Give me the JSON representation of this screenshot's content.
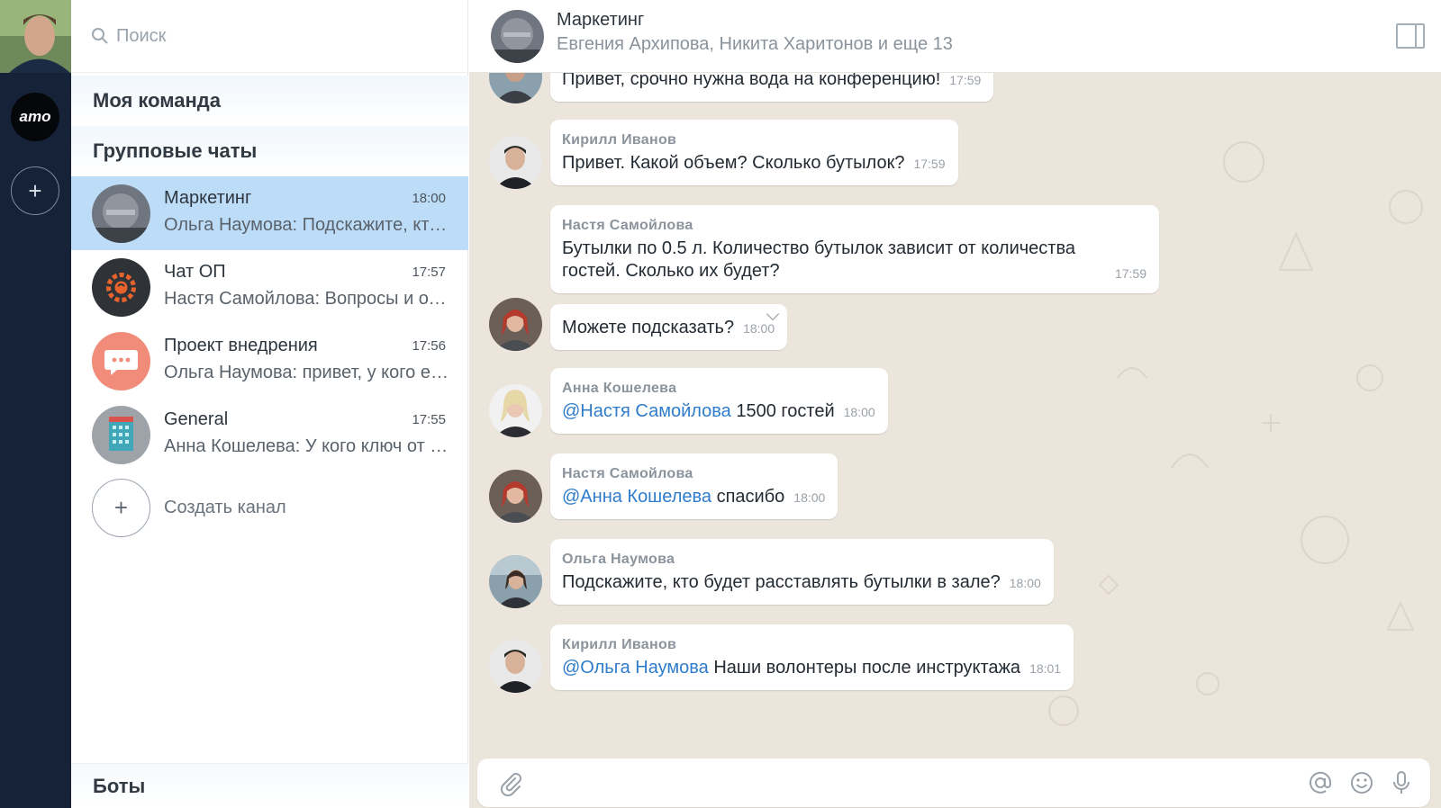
{
  "sidebar": {
    "logo_text": "amo"
  },
  "chat_list": {
    "search_placeholder": "Поиск",
    "sections": {
      "my_team": "Моя команда",
      "group_chats": "Групповые чаты",
      "bots": "Боты"
    },
    "chats": [
      {
        "name": "Маркетинг",
        "time": "18:00",
        "preview": "Ольга Наумова: Подскажите, кто будет расставлять бутылки в зале?",
        "active": true
      },
      {
        "name": "Чат ОП",
        "time": "17:57",
        "preview": "Настя Самойлова: Вопросы и ответы",
        "active": false
      },
      {
        "name": "Проект внедрения",
        "time": "17:56",
        "preview": "Ольга Наумова: привет, у кого есть доступ",
        "active": false
      },
      {
        "name": "General",
        "time": "17:55",
        "preview": "Анна Кошелева: У кого ключ от офиса?",
        "active": false
      }
    ],
    "create_channel": "Создать канал"
  },
  "conversation": {
    "title": "Маркетинг",
    "participants": "Евгения Архипова, Никита Харитонов и еще 13",
    "messages": [
      {
        "author": "",
        "mention": "",
        "text": "Привет, срочно нужна вода на конференцию!",
        "time": "17:59"
      },
      {
        "author": "Кирилл Иванов",
        "mention": "",
        "text": "Привет. Какой объем? Сколько бутылок?",
        "time": "17:59"
      },
      {
        "author": "Настя Самойлова",
        "mention": "",
        "text": "Бутылки по 0.5 л. Количество бутылок зависит от количества гостей. Сколько их будет?",
        "time": "17:59"
      },
      {
        "author": "",
        "mention": "",
        "text": "Можете подсказать?",
        "time": "18:00"
      },
      {
        "author": "Анна Кошелева",
        "mention": "@Настя Самойлова",
        "text": " 1500 гостей",
        "time": "18:00"
      },
      {
        "author": "Настя Самойлова",
        "mention": "@Анна Кошелева",
        "text": " спасибо",
        "time": "18:00"
      },
      {
        "author": "Ольга Наумова",
        "mention": "",
        "text": "Подскажите, кто будет расставлять бутылки в зале?",
        "time": "18:00"
      },
      {
        "author": "Кирилл Иванов",
        "mention": "@Ольга Наумова",
        "text": " Наши волонтеры после инструктажа",
        "time": "18:01"
      }
    ]
  },
  "colors": {
    "rail": "#152238",
    "active_chat": "#bcdcf7",
    "chat_background": "#ebe5dc",
    "mention": "#2f7ccb"
  }
}
